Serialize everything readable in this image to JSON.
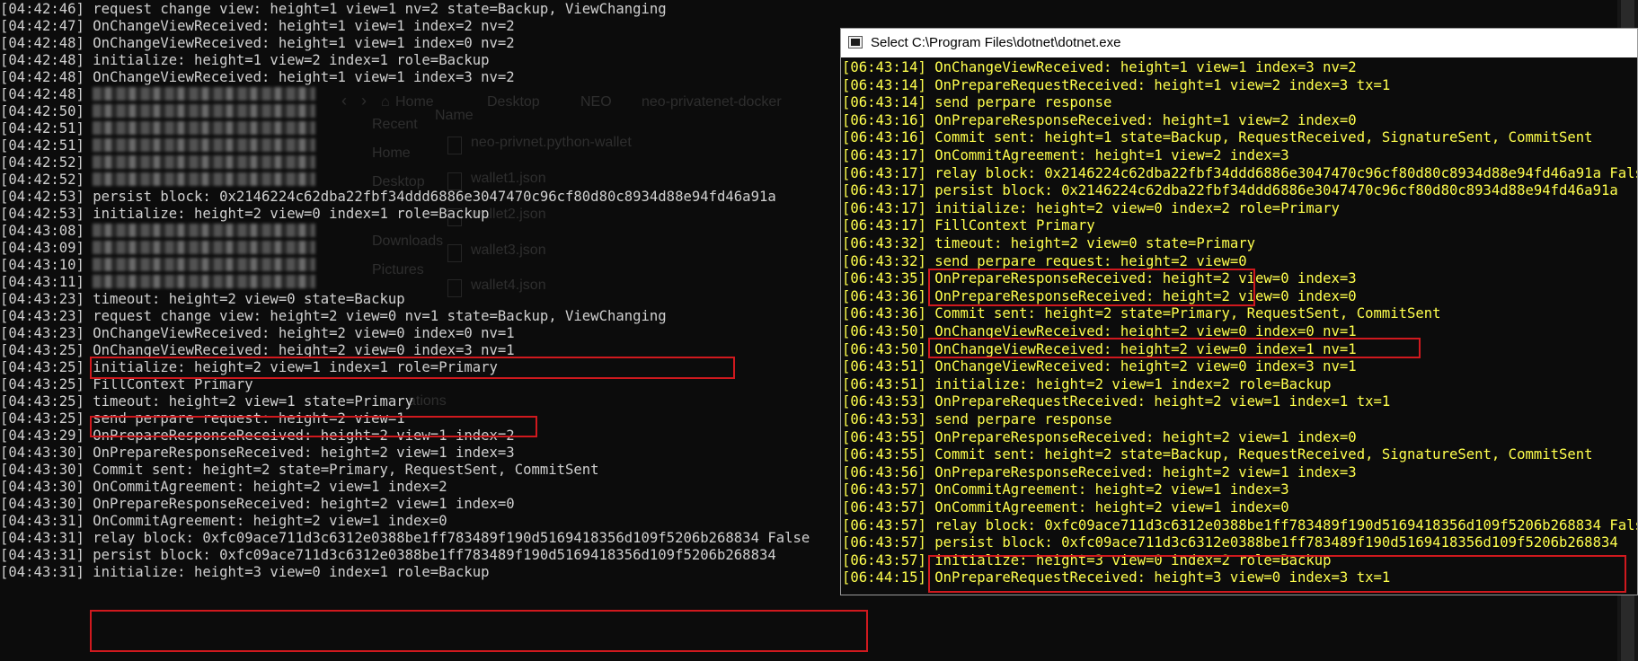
{
  "left_console": {
    "lines": [
      {
        "ts": "[04:42:46]",
        "msg": "request change view: height=1 view=1 nv=2 state=Backup, ViewChanging",
        "blurred": false
      },
      {
        "ts": "[04:42:47]",
        "msg": "OnChangeViewReceived: height=1 view=1 index=2 nv=2",
        "blurred": false
      },
      {
        "ts": "[04:42:48]",
        "msg": "OnChangeViewReceived: height=1 view=1 index=0 nv=2",
        "blurred": false
      },
      {
        "ts": "[04:42:48]",
        "msg": "initialize: height=1 view=2 index=1 role=Backup",
        "blurred": false
      },
      {
        "ts": "[04:42:48]",
        "msg": "OnChangeViewReceived: height=1 view=1 index=3 nv=2",
        "blurred": false
      },
      {
        "ts": "[04:42:48]",
        "msg": "",
        "blurred": true
      },
      {
        "ts": "[04:42:50]",
        "msg": "",
        "blurred": true
      },
      {
        "ts": "[04:42:51]",
        "msg": "",
        "blurred": true
      },
      {
        "ts": "[04:42:51]",
        "msg": "",
        "blurred": true
      },
      {
        "ts": "[04:42:52]",
        "msg": "",
        "blurred": true
      },
      {
        "ts": "[04:42:52]",
        "msg": "",
        "blurred": true
      },
      {
        "ts": "[04:42:53]",
        "msg": "persist block: 0x2146224c62dba22fbf34ddd6886e3047470c96cf80d80c8934d88e94fd46a91a",
        "blurred": false
      },
      {
        "ts": "[04:42:53]",
        "msg": "initialize: height=2 view=0 index=1 role=Backup",
        "blurred": false
      },
      {
        "ts": "[04:43:08]",
        "msg": "",
        "blurred": true
      },
      {
        "ts": "[04:43:09]",
        "msg": "",
        "blurred": true
      },
      {
        "ts": "[04:43:10]",
        "msg": "",
        "blurred": true
      },
      {
        "ts": "[04:43:11]",
        "msg": "",
        "blurred": true
      },
      {
        "ts": "[04:43:23]",
        "msg": "timeout: height=2 view=0 state=Backup",
        "blurred": false
      },
      {
        "ts": "[04:43:23]",
        "msg": "request change view: height=2 view=0 nv=1 state=Backup, ViewChanging",
        "blurred": false
      },
      {
        "ts": "[04:43:23]",
        "msg": "OnChangeViewReceived: height=2 view=0 index=0 nv=1",
        "blurred": false
      },
      {
        "ts": "[04:43:25]",
        "msg": "OnChangeViewReceived: height=2 view=0 index=3 nv=1",
        "blurred": false
      },
      {
        "ts": "[04:43:25]",
        "msg": "initialize: height=2 view=1 index=1 role=Primary",
        "blurred": false
      },
      {
        "ts": "[04:43:25]",
        "msg": "FillContext Primary",
        "blurred": false
      },
      {
        "ts": "[04:43:25]",
        "msg": "timeout: height=2 view=1 state=Primary",
        "blurred": false
      },
      {
        "ts": "[04:43:25]",
        "msg": "send perpare request: height=2 view=1",
        "blurred": false
      },
      {
        "ts": "[04:43:29]",
        "msg": "OnPrepareResponseReceived: height=2 view=1 index=2",
        "blurred": false
      },
      {
        "ts": "[04:43:30]",
        "msg": "OnPrepareResponseReceived: height=2 view=1 index=3",
        "blurred": false
      },
      {
        "ts": "[04:43:30]",
        "msg": "Commit sent: height=2 state=Primary, RequestSent, CommitSent",
        "blurred": false
      },
      {
        "ts": "[04:43:30]",
        "msg": "OnCommitAgreement: height=2 view=1 index=2",
        "blurred": false
      },
      {
        "ts": "[04:43:30]",
        "msg": "OnPrepareResponseReceived: height=2 view=1 index=0",
        "blurred": false
      },
      {
        "ts": "[04:43:31]",
        "msg": "OnCommitAgreement: height=2 view=1 index=0",
        "blurred": false
      },
      {
        "ts": "[04:43:31]",
        "msg": "relay block: 0xfc09ace711d3c6312e0388be1ff783489f190d5169418356d109f5206b268834 False",
        "blurred": false
      },
      {
        "ts": "[04:43:31]",
        "msg": "persist block: 0xfc09ace711d3c6312e0388be1ff783489f190d5169418356d109f5206b268834",
        "blurred": false
      },
      {
        "ts": "[04:43:31]",
        "msg": "initialize: height=3 view=0 index=1 role=Backup",
        "blurred": false
      }
    ]
  },
  "background_explorer": {
    "breadcrumb": [
      "Home",
      "Desktop",
      "NEO",
      "neo-privatenet-docker"
    ],
    "sidebar": [
      "Recent",
      "Home",
      "Desktop",
      "Downloads",
      "Pictures"
    ],
    "column_header": "Name",
    "files": [
      "neo-privnet.python-wallet",
      "wallet1.json",
      "wallet2.json",
      "wallet3.json",
      "wallet4.json"
    ],
    "partial_label": "ations"
  },
  "right_window": {
    "title": "Select C:\\Program Files\\dotnet\\dotnet.exe",
    "lines": [
      {
        "ts": "[06:43:14]",
        "msg": "OnChangeViewReceived: height=1 view=1 index=3 nv=2"
      },
      {
        "ts": "[06:43:14]",
        "msg": "OnPrepareRequestReceived: height=1 view=2 index=3 tx=1"
      },
      {
        "ts": "[06:43:14]",
        "msg": "send perpare response"
      },
      {
        "ts": "[06:43:16]",
        "msg": "OnPrepareResponseReceived: height=1 view=2 index=0"
      },
      {
        "ts": "[06:43:16]",
        "msg": "Commit sent: height=1 state=Backup, RequestReceived, SignatureSent, CommitSent"
      },
      {
        "ts": "[06:43:17]",
        "msg": "OnCommitAgreement: height=1 view=2 index=3"
      },
      {
        "ts": "[06:43:17]",
        "msg": "relay block: 0x2146224c62dba22fbf34ddd6886e3047470c96cf80d80c8934d88e94fd46a91a False"
      },
      {
        "ts": "[06:43:17]",
        "msg": "persist block: 0x2146224c62dba22fbf34ddd6886e3047470c96cf80d80c8934d88e94fd46a91a"
      },
      {
        "ts": "[06:43:17]",
        "msg": "initialize: height=2 view=0 index=2 role=Primary"
      },
      {
        "ts": "[06:43:17]",
        "msg": "FillContext Primary"
      },
      {
        "ts": "[06:43:32]",
        "msg": "timeout: height=2 view=0 state=Primary"
      },
      {
        "ts": "[06:43:32]",
        "msg": "send perpare request: height=2 view=0"
      },
      {
        "ts": "[06:43:35]",
        "msg": "OnPrepareResponseReceived: height=2 view=0 index=3"
      },
      {
        "ts": "[06:43:36]",
        "msg": "OnPrepareResponseReceived: height=2 view=0 index=0"
      },
      {
        "ts": "[06:43:36]",
        "msg": "Commit sent: height=2 state=Primary, RequestSent, CommitSent"
      },
      {
        "ts": "[06:43:50]",
        "msg": "OnChangeViewReceived: height=2 view=0 index=0 nv=1"
      },
      {
        "ts": "[06:43:50]",
        "msg": "OnChangeViewReceived: height=2 view=0 index=1 nv=1"
      },
      {
        "ts": "[06:43:51]",
        "msg": "OnChangeViewReceived: height=2 view=0 index=3 nv=1"
      },
      {
        "ts": "[06:43:51]",
        "msg": "initialize: height=2 view=1 index=2 role=Backup"
      },
      {
        "ts": "[06:43:53]",
        "msg": "OnPrepareRequestReceived: height=2 view=1 index=1 tx=1"
      },
      {
        "ts": "[06:43:53]",
        "msg": "send perpare response"
      },
      {
        "ts": "[06:43:55]",
        "msg": "OnPrepareResponseReceived: height=2 view=1 index=0"
      },
      {
        "ts": "[06:43:55]",
        "msg": "Commit sent: height=2 state=Backup, RequestReceived, SignatureSent, CommitSent"
      },
      {
        "ts": "[06:43:56]",
        "msg": "OnPrepareResponseReceived: height=2 view=1 index=3"
      },
      {
        "ts": "[06:43:57]",
        "msg": "OnCommitAgreement: height=2 view=1 index=3"
      },
      {
        "ts": "[06:43:57]",
        "msg": "OnCommitAgreement: height=2 view=1 index=0"
      },
      {
        "ts": "[06:43:57]",
        "msg": "relay block: 0xfc09ace711d3c6312e0388be1ff783489f190d5169418356d109f5206b268834 False"
      },
      {
        "ts": "[06:43:57]",
        "msg": "persist block: 0xfc09ace711d3c6312e0388be1ff783489f190d5169418356d109f5206b268834"
      },
      {
        "ts": "[06:43:57]",
        "msg": "initialize: height=3 view=0 index=2 role=Backup"
      },
      {
        "ts": "[06:44:15]",
        "msg": "OnPrepareRequestReceived: height=3 view=0 index=3 tx=1"
      }
    ]
  },
  "colors": {
    "console_bg": "#0c0c0c",
    "left_text": "#d0d0d0",
    "right_text": "#ffff4d",
    "highlight_box": "#d0191e",
    "titlebar_bg": "#ffffff"
  }
}
